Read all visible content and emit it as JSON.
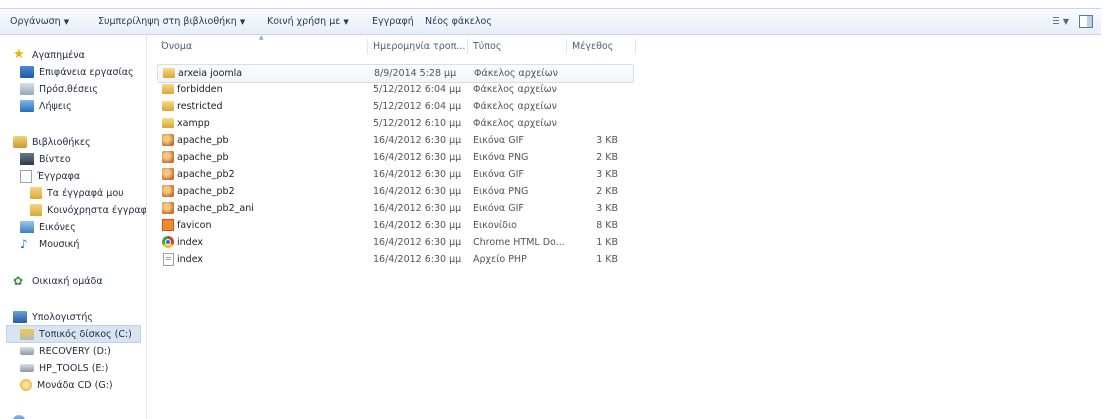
{
  "toolbar": {
    "organize": "Οργάνωση",
    "include_library": "Συμπερίληψη στη βιβλιοθήκη",
    "share_with": "Κοινή χρήση με",
    "burn": "Εγγραφή",
    "new_folder": "Νέος φάκελος"
  },
  "nav": {
    "favorites": "Αγαπημένα",
    "desktop": "Επιφάνεια εργασίας",
    "recent": "Πρόσ.θέσεις",
    "downloads": "Λήψεις",
    "libraries": "Βιβλιοθήκες",
    "videos": "Βίντεο",
    "documents": "Έγγραφα",
    "my_documents": "Τα έγγραφά μου",
    "public_documents": "Κοινόχρηστα έγγραφα",
    "pictures": "Εικόνες",
    "music": "Μουσική",
    "homegroup": "Οικιακή ομάδα",
    "computer": "Υπολογιστής",
    "local_disk": "Τοπικός δίσκος (C:)",
    "recovery": "RECOVERY (D:)",
    "hp_tools": "HP_TOOLS (E:)",
    "cd_drive": "Μονάδα CD (G:)"
  },
  "columns": {
    "name": "Όνομα",
    "date": "Ημερομηνία τροπ...",
    "type": "Τύπος",
    "size": "Μέγεθος"
  },
  "files": [
    {
      "name": "arxeia joomla",
      "date": "8/9/2014 5:28 μμ",
      "type": "Φάκελος αρχείων",
      "size": "",
      "icon": "folder-icon"
    },
    {
      "name": "forbidden",
      "date": "5/12/2012 6:04 μμ",
      "type": "Φάκελος αρχείων",
      "size": "",
      "icon": "folder-icon"
    },
    {
      "name": "restricted",
      "date": "5/12/2012 6:04 μμ",
      "type": "Φάκελος αρχείων",
      "size": "",
      "icon": "folder-icon"
    },
    {
      "name": "xampp",
      "date": "5/12/2012 6:10 μμ",
      "type": "Φάκελος αρχείων",
      "size": "",
      "icon": "folder-icon"
    },
    {
      "name": "apache_pb",
      "date": "16/4/2012 6:30 μμ",
      "type": "Εικόνα GIF",
      "size": "3 KB",
      "icon": "image-icon"
    },
    {
      "name": "apache_pb",
      "date": "16/4/2012 6:30 μμ",
      "type": "Εικόνα PNG",
      "size": "2 KB",
      "icon": "image-icon"
    },
    {
      "name": "apache_pb2",
      "date": "16/4/2012 6:30 μμ",
      "type": "Εικόνα GIF",
      "size": "3 KB",
      "icon": "image-icon"
    },
    {
      "name": "apache_pb2",
      "date": "16/4/2012 6:30 μμ",
      "type": "Εικόνα PNG",
      "size": "2 KB",
      "icon": "image-icon"
    },
    {
      "name": "apache_pb2_ani",
      "date": "16/4/2012 6:30 μμ",
      "type": "Εικόνα GIF",
      "size": "3 KB",
      "icon": "image-icon"
    },
    {
      "name": "favicon",
      "date": "16/4/2012 6:30 μμ",
      "type": "Εικονίδιο",
      "size": "8 KB",
      "icon": "icon-file-icon"
    },
    {
      "name": "index",
      "date": "16/4/2012 6:30 μμ",
      "type": "Chrome HTML Do...",
      "size": "1 KB",
      "icon": "chrome-icon"
    },
    {
      "name": "index",
      "date": "16/4/2012 6:30 μμ",
      "type": "Αρχείο PHP",
      "size": "1 KB",
      "icon": "php-file-icon"
    }
  ]
}
